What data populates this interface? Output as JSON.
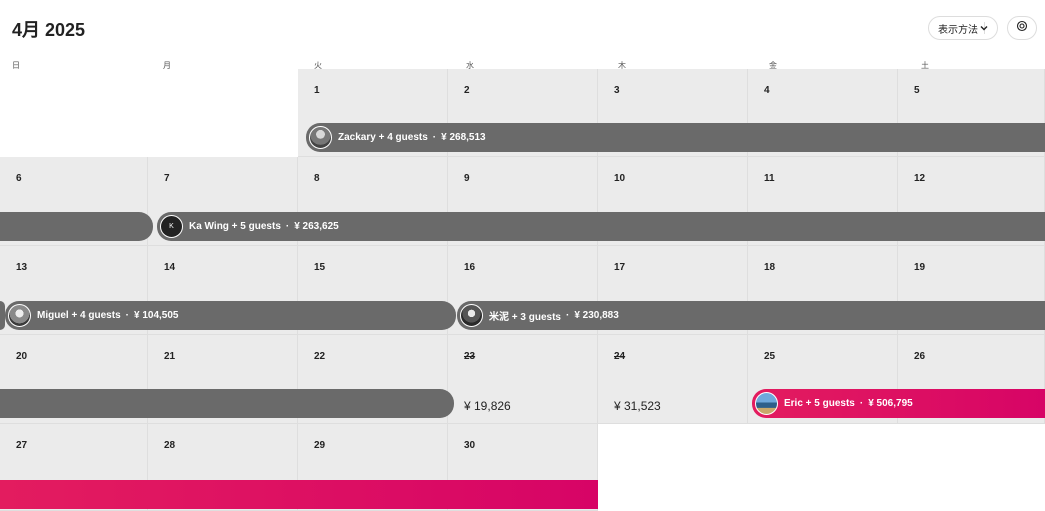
{
  "header": {
    "title": "4月 2025",
    "view_label": "表示方法"
  },
  "weekdays": [
    "日",
    "月",
    "火",
    "水",
    "木",
    "金",
    "土"
  ],
  "days": {
    "d1": "1",
    "d2": "2",
    "d3": "3",
    "d4": "4",
    "d5": "5",
    "d6": "6",
    "d7": "7",
    "d8": "8",
    "d9": "9",
    "d10": "10",
    "d11": "11",
    "d12": "12",
    "d13": "13",
    "d14": "14",
    "d15": "15",
    "d16": "16",
    "d17": "17",
    "d18": "18",
    "d19": "19",
    "d20": "20",
    "d21": "21",
    "d22": "22",
    "d23": "23",
    "d24": "24",
    "d25": "25",
    "d26": "26",
    "d27": "27",
    "d28": "28",
    "d29": "29",
    "d30": "30"
  },
  "prices": {
    "d23": "¥ 19,826",
    "d24": "¥ 31,523"
  },
  "reservations": {
    "zackary": {
      "guest": "Zackary + 4 guests",
      "dot": "·",
      "amount": "¥ 268,513"
    },
    "kawing": {
      "initial": "K",
      "guest": "Ka Wing + 5 guests",
      "dot": "·",
      "amount": "¥ 263,625"
    },
    "miguel": {
      "guest": "Miguel + 4 guests",
      "dot": "·",
      "amount": "¥ 104,505"
    },
    "mini": {
      "guest": "米泥 + 3 guests",
      "dot": "·",
      "amount": "¥ 230,883"
    },
    "eric": {
      "guest": "Eric + 5 guests",
      "dot": "·",
      "amount": "¥ 506,795"
    }
  },
  "colors": {
    "booking_past": "#6a6a6a",
    "booking_upcoming": "#e31c5f",
    "cell_bg": "#ebebeb"
  }
}
